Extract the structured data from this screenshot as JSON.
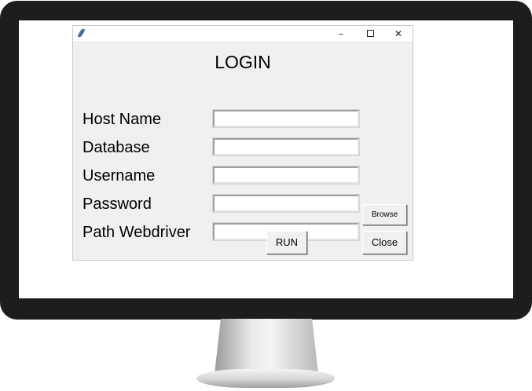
{
  "window": {
    "title": "",
    "minimize_glyph": "–",
    "close_glyph": "✕"
  },
  "login": {
    "heading": "LOGIN",
    "fields": [
      {
        "label": "Host Name",
        "value": ""
      },
      {
        "label": "Database",
        "value": ""
      },
      {
        "label": "Username",
        "value": ""
      },
      {
        "label": "Password",
        "value": ""
      },
      {
        "label": "Path Webdriver",
        "value": ""
      }
    ],
    "browse_label": "Browse",
    "run_label": "RUN",
    "close_label": "Close"
  }
}
